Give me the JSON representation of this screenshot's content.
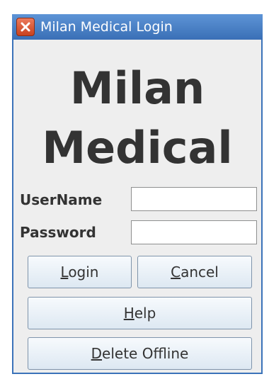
{
  "window": {
    "title": "Milan Medical Login",
    "close_icon": "close-icon"
  },
  "heading": {
    "line1": "Milan",
    "line2": "Medical"
  },
  "form": {
    "username_label": "UserName",
    "username_value": "",
    "password_label": "Password",
    "password_value": ""
  },
  "buttons": {
    "login": {
      "mnemonic": "L",
      "rest": "ogin"
    },
    "cancel": {
      "mnemonic": "C",
      "rest": "ancel"
    },
    "help": {
      "mnemonic": "H",
      "rest": "elp"
    },
    "delete_offline": {
      "mnemonic": "D",
      "rest": "elete Offline"
    }
  },
  "colors": {
    "titlebar": "#3a6fb6",
    "close_button": "#c8421f",
    "window_background": "#eeeeee",
    "heading_text": "#333333"
  }
}
